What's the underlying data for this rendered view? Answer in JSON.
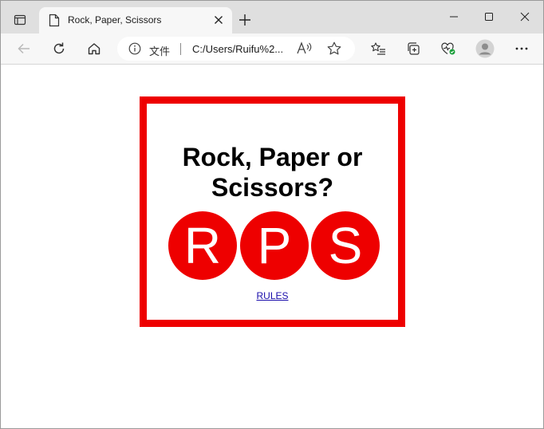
{
  "browser": {
    "tab": {
      "title": "Rock, Paper, Scissors"
    },
    "address_bar": {
      "scheme_label": "文件",
      "url": "C:/Users/Ruifu%2..."
    }
  },
  "game": {
    "title": "Rock, Paper or Scissors?",
    "choices": [
      {
        "letter": "R"
      },
      {
        "letter": "P"
      },
      {
        "letter": "S"
      }
    ],
    "rules_link": "RULES"
  },
  "colors": {
    "accent": "#ee0000",
    "link": "#1a0dab"
  }
}
